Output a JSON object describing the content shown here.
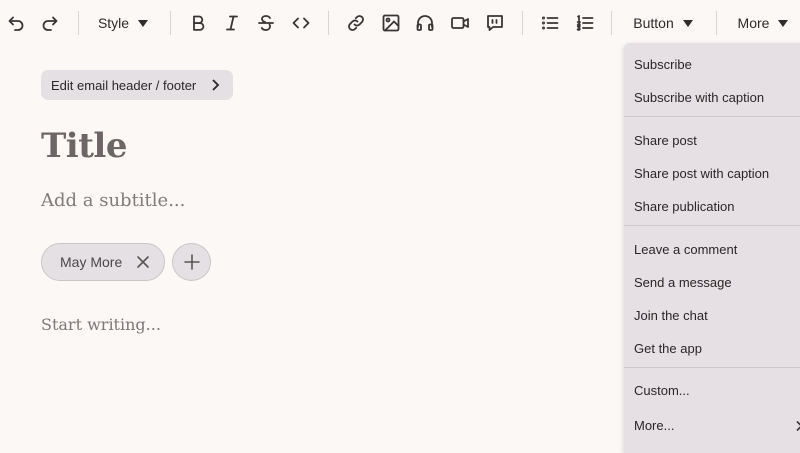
{
  "toolbar": {
    "style_label": "Style",
    "button_label": "Button",
    "more_label": "More"
  },
  "editor": {
    "header_footer_label": "Edit email header / footer",
    "title_placeholder": "Title",
    "subtitle_placeholder": "Add a subtitle...",
    "author_tag": "May More",
    "body_placeholder": "Start writing..."
  },
  "button_menu": {
    "items": [
      "Subscribe",
      "Subscribe with caption",
      "Share post",
      "Share post with caption",
      "Share publication",
      "Leave a comment",
      "Send a message",
      "Join the chat",
      "Get the app",
      "Custom...",
      "More..."
    ]
  },
  "icons": [
    "undo-icon",
    "redo-icon",
    "bold-icon",
    "italic-icon",
    "strikethrough-icon",
    "code-icon",
    "link-icon",
    "image-icon",
    "audio-icon",
    "video-icon",
    "quote-icon",
    "bullet-list-icon",
    "numbered-list-icon",
    "chevron-right-icon",
    "close-icon",
    "plus-icon"
  ]
}
